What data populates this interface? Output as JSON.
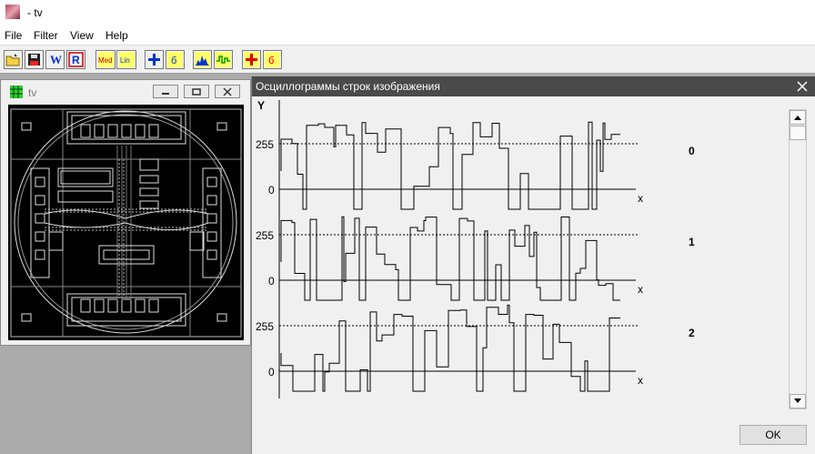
{
  "window": {
    "title": "- tv"
  },
  "menu": [
    "File",
    "Filter",
    "View",
    "Help"
  ],
  "toolbar": {
    "buttons": [
      {
        "name": "open-icon"
      },
      {
        "name": "save-icon"
      },
      {
        "name": "w-icon"
      },
      {
        "name": "r-icon"
      },
      {
        "name": "med-filter-icon",
        "label": "Med"
      },
      {
        "name": "lin-filter-icon",
        "label": "Lin"
      },
      {
        "name": "plus-icon"
      },
      {
        "name": "b-icon"
      },
      {
        "name": "histogram-icon"
      },
      {
        "name": "waveform-icon"
      },
      {
        "name": "red-plus-icon"
      },
      {
        "name": "red-b-icon"
      }
    ]
  },
  "child_window": {
    "title": "tv"
  },
  "dialog": {
    "title": "Осциллограммы строк изображения",
    "ok_label": "OK",
    "y_axis": "Y",
    "x_axis": "x",
    "channels": [
      {
        "id": "0",
        "level_high": "255",
        "level_low": "0"
      },
      {
        "id": "1",
        "level_high": "255",
        "level_low": "0"
      },
      {
        "id": "2",
        "level_high": "255",
        "level_low": "0"
      }
    ]
  }
}
